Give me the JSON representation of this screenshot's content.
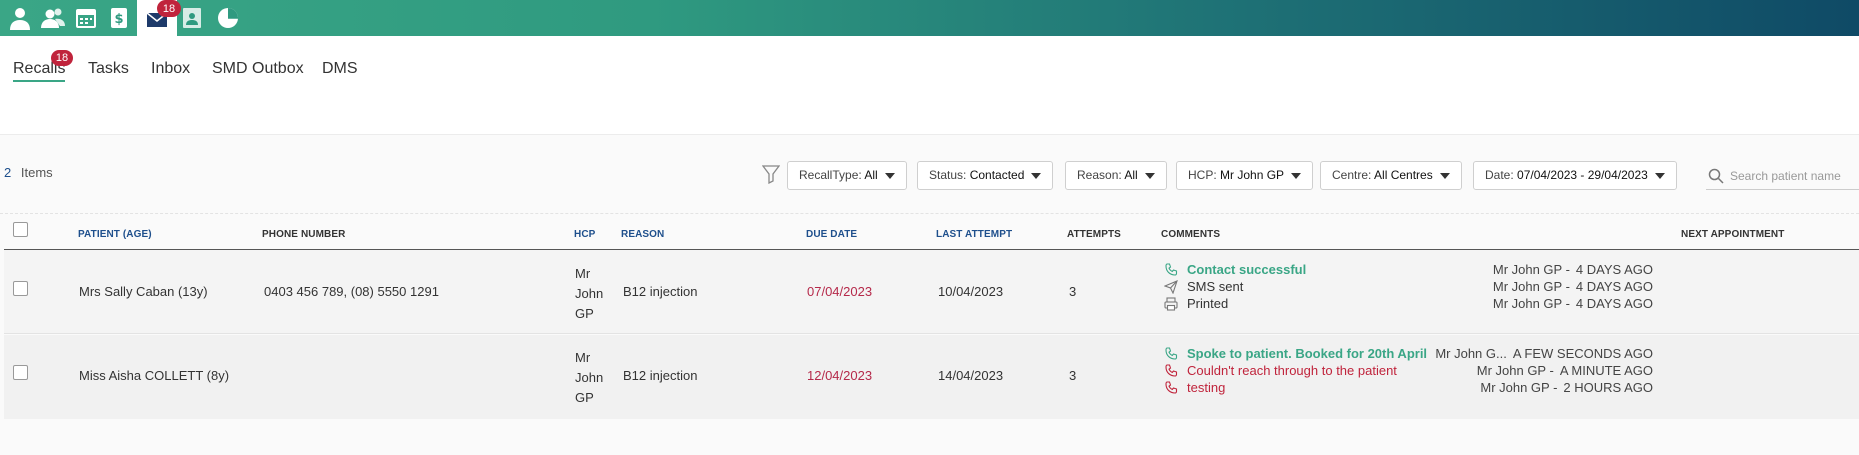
{
  "nav": {
    "icons": [
      "person-icon",
      "people-icon",
      "calendar-icon",
      "billing-icon",
      "mail-icon",
      "contacts-icon",
      "reports-icon"
    ],
    "mail_badge": "18"
  },
  "tabs": [
    {
      "label": "Recalls",
      "badge": "18",
      "active": true
    },
    {
      "label": "Tasks"
    },
    {
      "label": "Inbox"
    },
    {
      "label": "SMD Outbox"
    },
    {
      "label": "DMS"
    }
  ],
  "summary": {
    "count": "2",
    "label": "Items"
  },
  "filters": [
    {
      "label": "RecallType:",
      "value": "All"
    },
    {
      "label": "Status:",
      "value": "Contacted"
    },
    {
      "label": "Reason:",
      "value": "All"
    },
    {
      "label": "HCP:",
      "value": "Mr John GP"
    },
    {
      "label": "Centre:",
      "value": "All Centres"
    },
    {
      "label": "Date:",
      "value": "07/04/2023 - 29/04/2023"
    }
  ],
  "search": {
    "placeholder": "Search patient name",
    "value": ""
  },
  "columns": [
    "PATIENT (AGE)",
    "PHONE NUMBER",
    "HCP",
    "REASON",
    "DUE DATE",
    "LAST ATTEMPT",
    "ATTEMPTS",
    "COMMENTS",
    "NEXT APPOINTMENT"
  ],
  "rows": [
    {
      "patient": "Mrs Sally Caban (13y)",
      "phone": "0403 456 789, (08) 5550 1291",
      "hcp": [
        "Mr",
        "John",
        "GP"
      ],
      "reason": "B12 injection",
      "due_date": "07/04/2023",
      "last_attempt": "10/04/2023",
      "attempts": "3",
      "comments": [
        {
          "icon": "phone-icon",
          "text": "Contact successful",
          "style": "green",
          "by": "Mr John GP -",
          "when": "4 DAYS AGO"
        },
        {
          "icon": "send-icon",
          "text": "SMS sent",
          "style": "gray",
          "by": "Mr John GP -",
          "when": "4 DAYS AGO"
        },
        {
          "icon": "printer-icon",
          "text": "Printed",
          "style": "gray",
          "by": "Mr John GP -",
          "when": "4 DAYS AGO"
        }
      ],
      "next_appointment": ""
    },
    {
      "patient": "Miss Aisha COLLETT (8y)",
      "phone": "",
      "hcp": [
        "Mr",
        "John",
        "GP"
      ],
      "reason": "B12 injection",
      "due_date": "12/04/2023",
      "last_attempt": "14/04/2023",
      "attempts": "3",
      "comments": [
        {
          "icon": "phone-icon",
          "text": "Spoke to patient. Booked for 20th April",
          "style": "green",
          "by": "Mr John G...",
          "when": "A FEW SECONDS AGO"
        },
        {
          "icon": "phone-icon",
          "text": "Couldn't reach through to the patient",
          "style": "red",
          "by": "Mr John GP -",
          "when": "A MINUTE AGO"
        },
        {
          "icon": "phone-icon",
          "text": "testing",
          "style": "red",
          "by": "Mr John GP -",
          "when": "2 HOURS AGO"
        }
      ],
      "next_appointment": ""
    }
  ],
  "colors": {
    "brand_green": "#3aa686",
    "brand_navy": "#0f4a66",
    "badge_red": "#c0243c",
    "due_red": "#b5294a",
    "header_blue": "#1e4f8c"
  }
}
